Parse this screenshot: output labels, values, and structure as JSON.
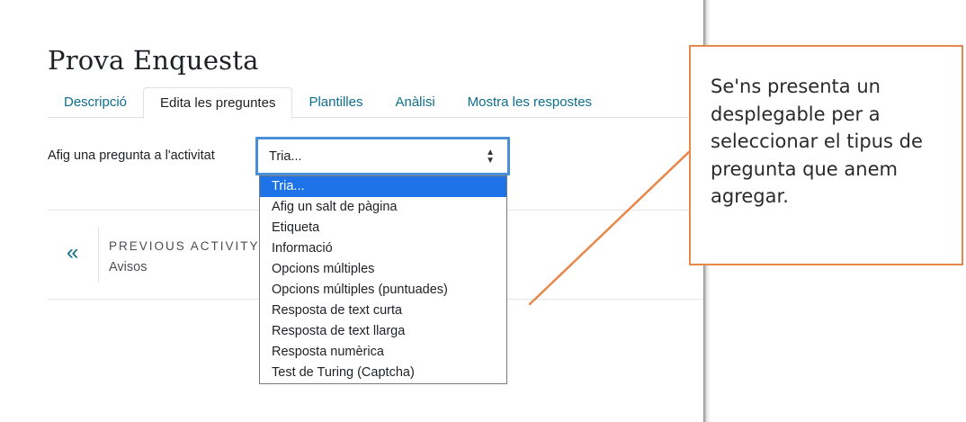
{
  "page": {
    "title": "Prova Enquesta"
  },
  "tabs": [
    {
      "label": "Descripció",
      "active": false
    },
    {
      "label": "Edita les preguntes",
      "active": true
    },
    {
      "label": "Plantilles",
      "active": false
    },
    {
      "label": "Anàlisi",
      "active": false
    },
    {
      "label": "Mostra les respostes",
      "active": false
    }
  ],
  "add_question": {
    "label": "Afig una pregunta a l'activitat",
    "selected_value": "Tria...",
    "options": [
      "Tria...",
      "Afig un salt de pàgina",
      "Etiqueta",
      "Informació",
      "Opcions múltiples",
      "Opcions múltiples (puntuades)",
      "Resposta de text curta",
      "Resposta de text llarga",
      "Resposta numèrica",
      "Test de Turing (Captcha)"
    ],
    "highlighted_option_index": 0
  },
  "previous_activity": {
    "label": "PREVIOUS ACTIVITY",
    "name": "Avisos",
    "icon": "double-chevron-left-icon"
  },
  "callout": {
    "text": "Se'ns presenta un desplegable per a seleccionar el tipus de pregunta que anem agregar.",
    "border_color": "#e8874a"
  },
  "colors": {
    "link": "#0f6e8c",
    "focus_border": "#4a90d9",
    "option_highlight": "#1e73e8",
    "callout_accent": "#e8874a"
  }
}
